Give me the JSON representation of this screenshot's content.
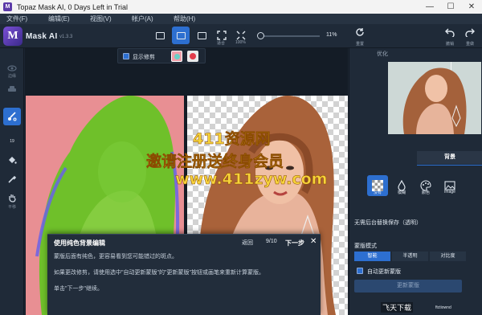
{
  "window": {
    "title": "Topaz Mask AI, 0 Days Left in Trial"
  },
  "menu": [
    "文件(F)",
    "编辑(E)",
    "视图(V)",
    "帐户(A)",
    "帮助(H)"
  ],
  "app": {
    "name": "Mask AI",
    "version": "v1.3.3",
    "logo_letter": "M"
  },
  "toolbar": {
    "view_labels": [
      "适合",
      "100%"
    ],
    "zoom_percent": "11%",
    "zoom_level": 0.0,
    "right_labels": [
      "撤销",
      "重做"
    ],
    "left_label": "重置"
  },
  "left_tools": {
    "labels": [
      "边缘",
      "",
      "",
      "19",
      "",
      "",
      "平移"
    ]
  },
  "mask_toolbar": {
    "show_mask_label": "显示修剪"
  },
  "dialog": {
    "title": "使用纯色背景编辑",
    "back": "返回",
    "counter": "9/10",
    "next": "下一步",
    "lines": [
      "蒙版后面有纯色，更容易看到您可能错过的斑点。",
      "如果更改修剪，请使用选中\"自动更新蒙版\"的\"更新蒙版\"按钮或画笔来重新计算蒙版。",
      "单击\"下一步\"继续。"
    ]
  },
  "right_panel": {
    "tabs": [
      "优化",
      "背景"
    ],
    "active_tab": "背景",
    "bg_options": [
      "没有",
      "模糊",
      "颜色",
      "Image"
    ],
    "info_text": "无需后台替换保存（透明）",
    "mask_mode_title": "蒙版模式",
    "mask_modes": [
      "智能",
      "半透明",
      "对比度"
    ],
    "auto_update_label": "自动更新蒙版",
    "update_button": "更新蒙版"
  },
  "overlay": {
    "line1": "411资源网",
    "line2": "邀请注册送终身会员",
    "url": "www.411zyw.com",
    "corner": "飞天下载",
    "corner_small": "ftctiownd"
  },
  "colors": {
    "accent": "#2d6fd0",
    "mask_overlay": "#e88f93",
    "mask_green": "#62c51f"
  }
}
